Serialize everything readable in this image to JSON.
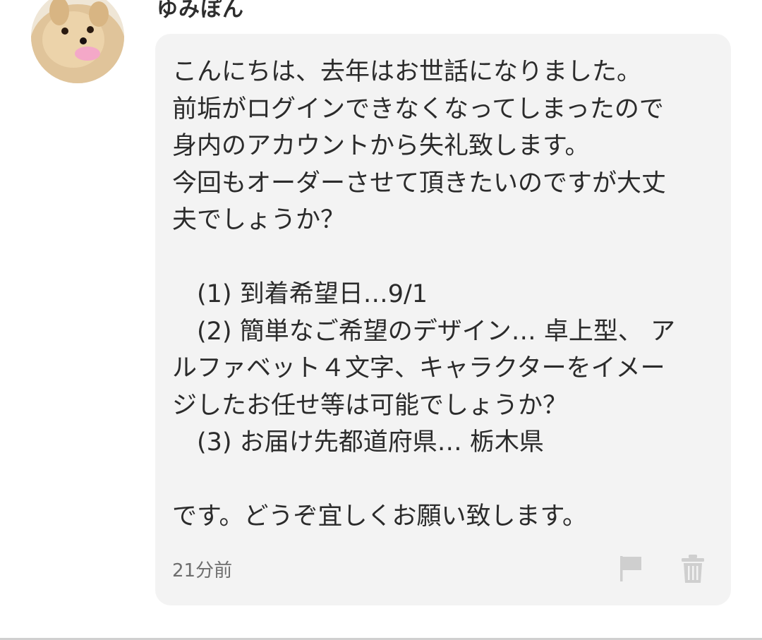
{
  "post": {
    "username": "ゆみぽん",
    "message_lines": [
      "こんにちは、去年はお世話になりました。",
      "前垢がログインできなくなってしまったので",
      "身内のアカウントから失礼致します。",
      "今回もオーダーさせて頂きたいのですが大丈",
      "夫でしょうか？",
      "",
      "　(1) 到着希望日…9/1",
      "　(2) 簡単なご希望のデザイン… 卓上型、 ア",
      "ルファベット４文字、キャラクターをイメー",
      "ジしたお任せ等は可能でしょうか？",
      "　(3) お届け先都道府県… 栃木県",
      "",
      "です。どうぞ宜しくお願い致します。"
    ],
    "timestamp": "21分前",
    "actions": {
      "flag_icon": "flag-icon",
      "delete_icon": "trash-icon"
    }
  },
  "colors": {
    "bubble_background": "#f3f3f3",
    "icon_color": "#cfcfcf",
    "timestamp_color": "#6e6e6e"
  }
}
